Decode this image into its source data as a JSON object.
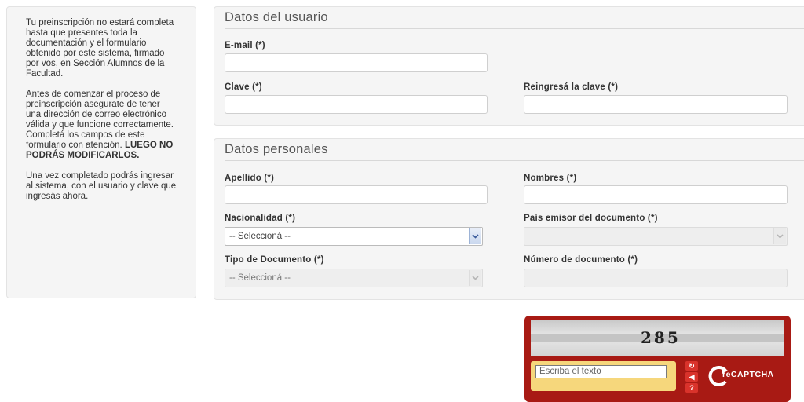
{
  "sidebar": {
    "paragraph1": "Tu preinscripción no estará completa hasta que presentes toda la documentación y el formulario obtenido por este sistema, firmado por vos, en Sección Alumnos de la Facultad.",
    "paragraph2": "Antes de comenzar el proceso de preinscripción asegurate de tener una dirección de correo electrónico válida y que funcione correctamente. Completá los campos de este formulario con atención.",
    "paragraph2_bold": "LUEGO NO PODRÁS MODIFICARLOS.",
    "paragraph3": "Una vez completado podrás ingresar al sistema, con el usuario y clave que ingresás ahora."
  },
  "user_section": {
    "legend": "Datos del usuario",
    "email_label": "E-mail (*)",
    "email_value": "",
    "password_label": "Clave (*)",
    "password_value": "",
    "password_confirm_label": "Reingresá la clave (*)",
    "password_confirm_value": ""
  },
  "personal_section": {
    "legend": "Datos personales",
    "apellido_label": "Apellido (*)",
    "apellido_value": "",
    "nombres_label": "Nombres (*)",
    "nombres_value": "",
    "nacionalidad_label": "Nacionalidad (*)",
    "nacionalidad_selected": "-- Seleccioná --",
    "pais_label": "País emisor del documento (*)",
    "pais_selected": "",
    "tipo_doc_label": "Tipo de Documento (*)",
    "tipo_doc_selected": "-- Seleccioná --",
    "numero_doc_label": "Número de documento (*)",
    "numero_doc_value": ""
  },
  "captcha": {
    "challenge_text": "285",
    "input_placeholder": "Escriba el texto",
    "brand": "reCAPTCHA",
    "colors": {
      "frame": "#a81a14",
      "input_bg": "#f6d77c"
    }
  }
}
